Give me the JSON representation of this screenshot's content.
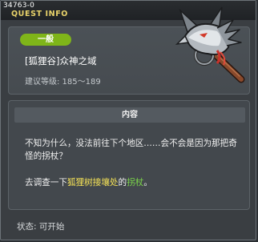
{
  "window": {
    "quest_id": "34763-0",
    "title": "QUEST INFO"
  },
  "info": {
    "badge": "一般",
    "quest_name": "[狐狸谷]众神之域",
    "level_requirement": "建议等级: 185～189"
  },
  "item_icon": "fox-spirit-staff-icon",
  "content": {
    "header": "内容",
    "paragraph1": "不知为什么，没法前往下个地区……会不会是因为那把奇怪的拐杖？",
    "paragraph2": {
      "prefix": "去调查一下",
      "place": "狐狸树接壤处",
      "middle": "的",
      "item": "拐杖",
      "suffix": "。"
    }
  },
  "status": "状态: 可开始",
  "colors": {
    "badge": "#7fb519",
    "title": "#e9d36a",
    "place_highlight": "#f5e257",
    "item_highlight": "#7ad34a"
  }
}
